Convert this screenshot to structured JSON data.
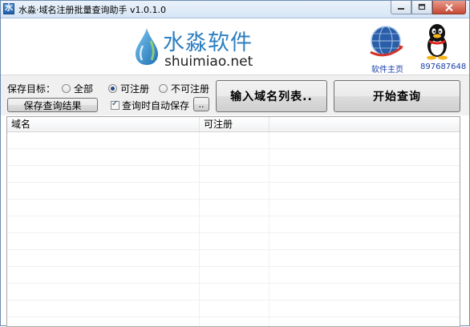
{
  "window": {
    "title": "水淼·域名注册批量查询助手 v1.0.1.0",
    "icon": "app-icon"
  },
  "header": {
    "logo_cn": "水淼软件",
    "logo_en": "shuimiao.net",
    "home_label": "软件主页",
    "qq_label": "897687648"
  },
  "controls": {
    "save_target_label": "保存目标：",
    "radios": [
      {
        "label": "全部",
        "checked": false
      },
      {
        "label": "可注册",
        "checked": true
      },
      {
        "label": "不可注册",
        "checked": false
      }
    ],
    "save_results_label": "保存查询结果",
    "auto_save_label": "查询时自动保存",
    "auto_save_checked": true,
    "dots_label": "..",
    "import_label": "输入域名列表..",
    "start_label": "开始查询"
  },
  "table": {
    "columns": [
      "域名",
      "可注册",
      ""
    ],
    "rows": []
  }
}
